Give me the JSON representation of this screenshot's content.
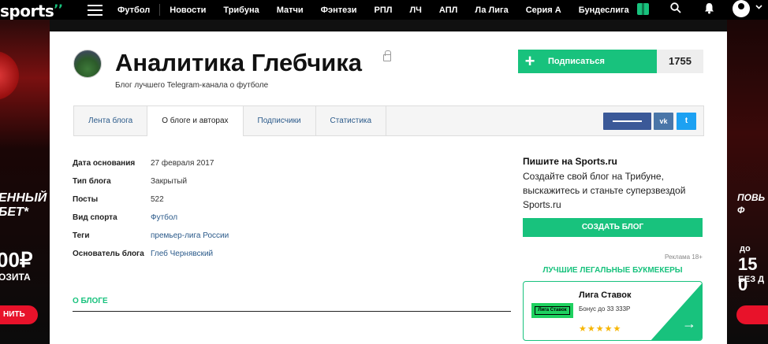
{
  "header": {
    "logo": "sports",
    "logo_mark": "’’",
    "nav": [
      "Футбол",
      "Новости",
      "Трибуна",
      "Матчи",
      "Фэнтези",
      "РПЛ",
      "ЛЧ",
      "АПЛ",
      "Ла Лига",
      "Серия А",
      "Бундеслига"
    ],
    "icons": [
      "menu-icon",
      "gift-icon",
      "search-icon",
      "bell-icon",
      "user-icon",
      "chevron-down-icon"
    ]
  },
  "ads": {
    "left": {
      "line1": "ЕННЫЙ",
      "line2": "БЕТ*",
      "amount": "00₽",
      "caption": "ОЗИТА",
      "button": "НИТЬ"
    },
    "right": {
      "line1": "ПОВЬ",
      "line2": "Ф",
      "prefix": "до",
      "amount": "15 0",
      "caption": "БЕЗ Д"
    }
  },
  "blog": {
    "title": "Аналитика Глебчика",
    "subtitle": "Блог лучшего Telegram-канала о футболе",
    "subscribe_label": "Подписаться",
    "subscribe_plus": "+",
    "subscribers": "1755"
  },
  "tabs": [
    "Лента блога",
    "О блоге и авторах",
    "Подписчики",
    "Статистика"
  ],
  "active_tab": "О блоге и авторах",
  "share": {
    "vk": "vk",
    "tw": "t"
  },
  "info": [
    {
      "key": "Дата основания",
      "value": "27 февраля 2017",
      "link": false
    },
    {
      "key": "Тип блога",
      "value": "Закрытый",
      "link": false
    },
    {
      "key": "Посты",
      "value": "522",
      "link": false
    },
    {
      "key": "Вид спорта",
      "value": "Футбол",
      "link": true
    },
    {
      "key": "Теги",
      "value": "премьер-лига России",
      "link": true
    },
    {
      "key": "Основатель блога",
      "value": "Глеб Чернявский",
      "link": true
    }
  ],
  "about_heading": "О БЛОГЕ",
  "sidebar": {
    "write_title": "Пишите на Sports.ru",
    "write_text": "Создайте свой блог на Трибуне, выскажитесь и станьте суперзвездой Sports.ru",
    "create_button": "СОЗДАТЬ БЛОГ",
    "ad_note": "Реклама 18+",
    "bookmakers_title": "ЛУЧШИЕ ЛЕГАЛЬНЫЕ БУКМЕКЕРЫ",
    "bookmaker": {
      "name": "Лига Ставок",
      "logo_text": "Лига Ставок",
      "bonus": "Бонус до 33 333Р",
      "rating": 5,
      "stars": "★★★★★",
      "arrow": "→"
    }
  },
  "colors": {
    "accent": "#18c27d",
    "link": "#2b5a8a",
    "topbar": "#000000",
    "fb": "#3b5998",
    "vk": "#4a76a8",
    "tw": "#1da1f2",
    "star": "#f7b500",
    "ad_button": "#e8122a"
  }
}
